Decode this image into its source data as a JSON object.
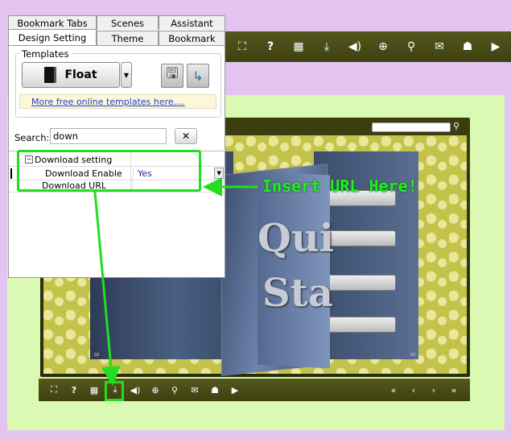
{
  "panel": {
    "tabs_row1": [
      "Bookmark Tabs",
      "Scenes",
      "Assistant"
    ],
    "tabs_row2": [
      "Design Setting",
      "Theme",
      "Bookmark"
    ],
    "templates_label": "Templates",
    "template_button": "Float",
    "more_templates_link": "More free online templates here....",
    "search_label": "Search:",
    "search_value": "down",
    "properties": {
      "group": "Download setting",
      "rows": [
        {
          "name": "Download Enable",
          "value": "Yes"
        },
        {
          "name": "Download URL",
          "value": ""
        }
      ]
    }
  },
  "annotation": {
    "text": "Insert URL Here!",
    "color": "#22dd22"
  },
  "book": {
    "title_words": [
      "Qui",
      "Sta"
    ],
    "page_numbers": [
      "02",
      "03"
    ]
  },
  "icons": {
    "top_toolbar": [
      "fit-screen-icon",
      "help-icon",
      "thumbnails-icon",
      "download-icon",
      "sound-icon",
      "zoom-in-icon",
      "search-icon",
      "email-icon",
      "social-share-icon",
      "autoplay-icon"
    ],
    "bottom_toolbar": [
      "fit-screen-icon",
      "help-icon",
      "thumbnails-icon",
      "download-icon",
      "sound-icon",
      "zoom-in-icon",
      "search-icon",
      "email-icon",
      "social-share-icon",
      "autoplay-icon",
      "first-page-icon",
      "previous-page-icon",
      "next-page-icon",
      "last-page-icon"
    ]
  },
  "colors": {
    "toolbar": "#4a4c16",
    "stage": "#daf9b2",
    "background": "#e3c4f1",
    "highlight": "#22dd22"
  }
}
